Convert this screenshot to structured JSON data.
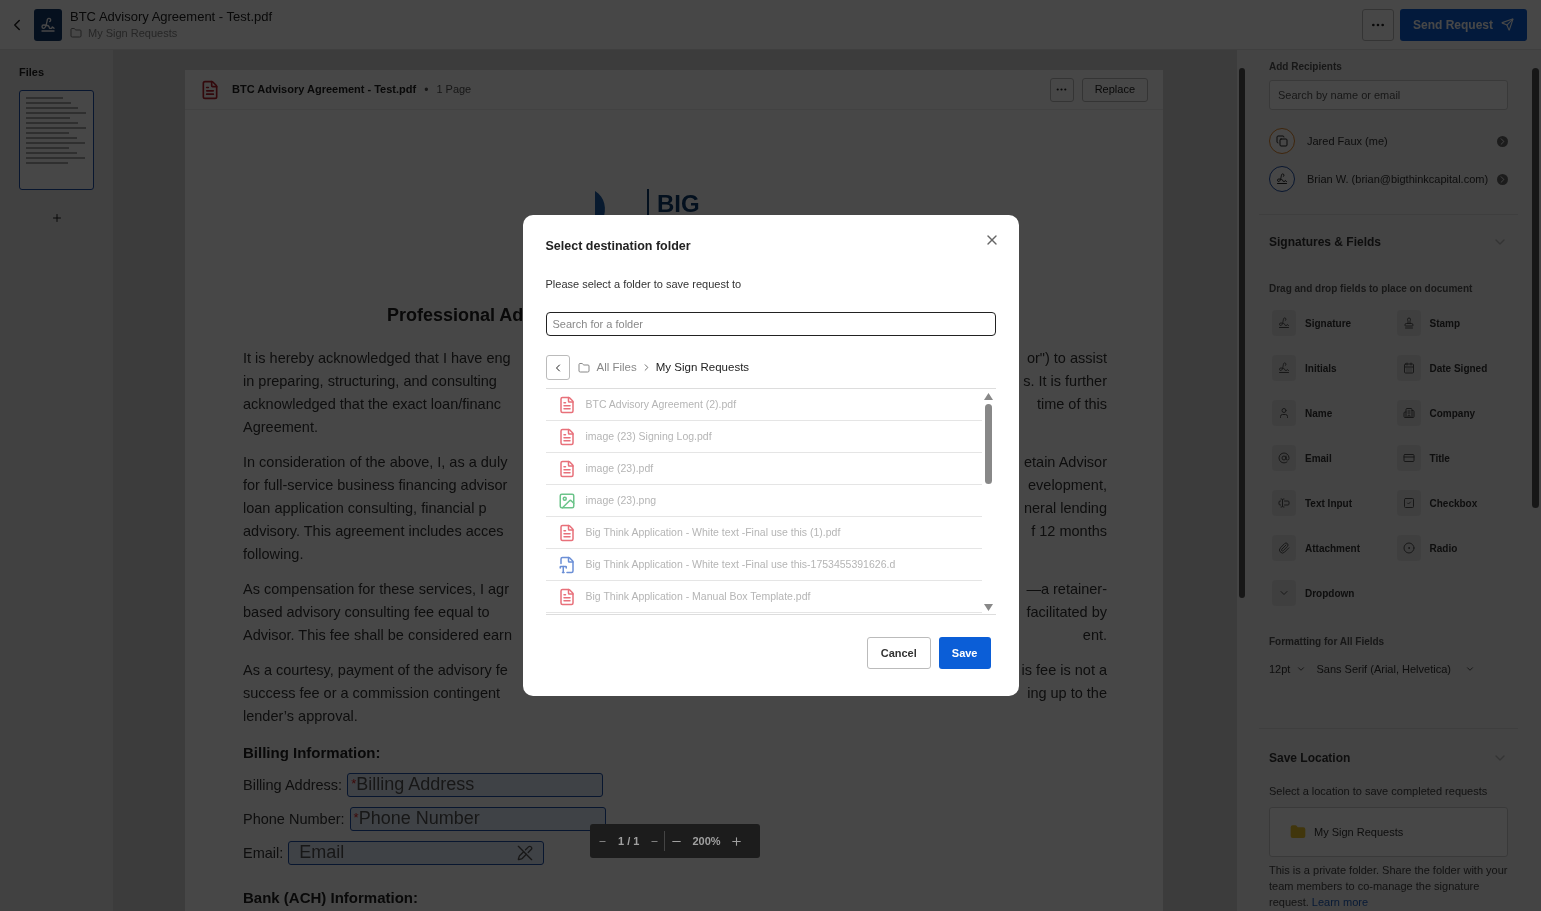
{
  "header": {
    "title": "BTC Advisory Agreement - Test.pdf",
    "folder": "My Sign Requests",
    "send_button": "Send Request"
  },
  "sidebar": {
    "title": "Files"
  },
  "document": {
    "file_name": "BTC Advisory Agreement - Test.pdf",
    "separator": "•",
    "pages": "1 Page",
    "replace_button": "Replace",
    "logo_text": "BIG",
    "heading": "Professional Ad",
    "paragraphs": [
      {
        "lines": [
          {
            "left": "It is hereby acknowledged that I have eng",
            "right": "or\") to assist"
          },
          {
            "left": "in preparing, structuring, and consulting",
            "right": "s. It is further"
          },
          {
            "left": "acknowledged that the exact loan/financ",
            "right": "time of this"
          },
          {
            "left": "Agreement."
          }
        ]
      },
      {
        "lines": [
          {
            "left": "In consideration of the above, I, as a duly",
            "right": "etain Advisor"
          },
          {
            "left": "for full-service business financing advisor",
            "right": "evelopment,"
          },
          {
            "left": "loan application consulting, financial p",
            "right": "neral lending"
          },
          {
            "left": "advisory. This agreement includes acces",
            "right": "f 12 months"
          },
          {
            "left": "following."
          }
        ]
      },
      {
        "lines": [
          {
            "left": "As compensation for these services, I agr",
            "right": "—a retainer-"
          },
          {
            "left": "based advisory consulting fee equal to",
            "right": "facilitated by"
          },
          {
            "left": "Advisor. This fee shall be considered earn",
            "right": "ent."
          }
        ]
      },
      {
        "lines": [
          {
            "left": "As a courtesy, payment of the advisory fe",
            "right": "is fee is not a"
          },
          {
            "left": "success fee or a commission contingent",
            "right": "ing up to the"
          },
          {
            "left": "lender’s approval."
          }
        ]
      }
    ],
    "billing_heading": "Billing Information:",
    "form_fields": [
      {
        "label": "Billing Address:",
        "marker": "*",
        "placeholder": "Billing Address",
        "kind": "text"
      },
      {
        "label": "Phone Number:",
        "marker": "*",
        "placeholder": "Phone Number",
        "kind": "text"
      },
      {
        "label": "Email:",
        "placeholder": "Email",
        "kind": "email"
      }
    ],
    "bank_heading": "Bank (ACH) Information:"
  },
  "zoom_bar": {
    "page": "1 / 1",
    "zoom": "200%"
  },
  "right_panel": {
    "recipients": {
      "label": "Add Recipients",
      "placeholder": "Search by name or email",
      "people": [
        {
          "name": "Jared Faux (me)",
          "kind": "sender"
        },
        {
          "name": "Brian W. (brian@bigthinkcapital.com)",
          "kind": "signer"
        }
      ]
    },
    "fields": {
      "title": "Signatures & Fields",
      "hint": "Drag and drop fields to place on document",
      "items": [
        {
          "label": "Signature",
          "kind": "signature"
        },
        {
          "label": "Stamp",
          "kind": "stamp"
        },
        {
          "label": "Initials",
          "kind": "initials"
        },
        {
          "label": "Date Signed",
          "kind": "date"
        },
        {
          "label": "Name",
          "kind": "name"
        },
        {
          "label": "Company",
          "kind": "company"
        },
        {
          "label": "Email",
          "kind": "email"
        },
        {
          "label": "Title",
          "kind": "title"
        },
        {
          "label": "Text Input",
          "kind": "text"
        },
        {
          "label": "Checkbox",
          "kind": "checkbox"
        },
        {
          "label": "Attachment",
          "kind": "attachment"
        },
        {
          "label": "Radio",
          "kind": "radio"
        },
        {
          "label": "Dropdown",
          "kind": "dropdown"
        }
      ]
    },
    "formatting": {
      "label": "Formatting for All Fields",
      "size": "12pt",
      "font": "Sans Serif (Arial, Helvetica)"
    },
    "save_location": {
      "title": "Save Location",
      "hint": "Select a location to save completed requests",
      "folder": "My Sign Requests",
      "note": "This is a private folder. Share the folder with your team members to co-manage the signature request.",
      "link": "Learn more"
    }
  },
  "modal": {
    "title": "Select destination folder",
    "subtitle": "Please select a folder to save request to",
    "search_placeholder": "Search for a folder",
    "breadcrumb": [
      {
        "label": "All Files",
        "selected": false
      },
      {
        "label": "My Sign Requests",
        "selected": true
      }
    ],
    "files": [
      {
        "name": "BTC Advisory Agreement (2).pdf",
        "kind": "pdf",
        "disabled": true
      },
      {
        "name": "image (23) Signing Log.pdf",
        "kind": "pdf",
        "disabled": true
      },
      {
        "name": "image (23).pdf",
        "kind": "pdf",
        "disabled": true
      },
      {
        "name": "image (23).png",
        "kind": "image",
        "disabled": true
      },
      {
        "name": "Big Think Application - White text -Final use this (1).pdf",
        "kind": "pdf",
        "disabled": true
      },
      {
        "name": "Big Think Application - White text -Final use this-1753455391626.d",
        "kind": "word",
        "disabled": true
      },
      {
        "name": "Big Think Application - Manual Box Template.pdf",
        "kind": "pdf",
        "disabled": true
      }
    ],
    "cancel_button": "Cancel",
    "save_button": "Save"
  }
}
